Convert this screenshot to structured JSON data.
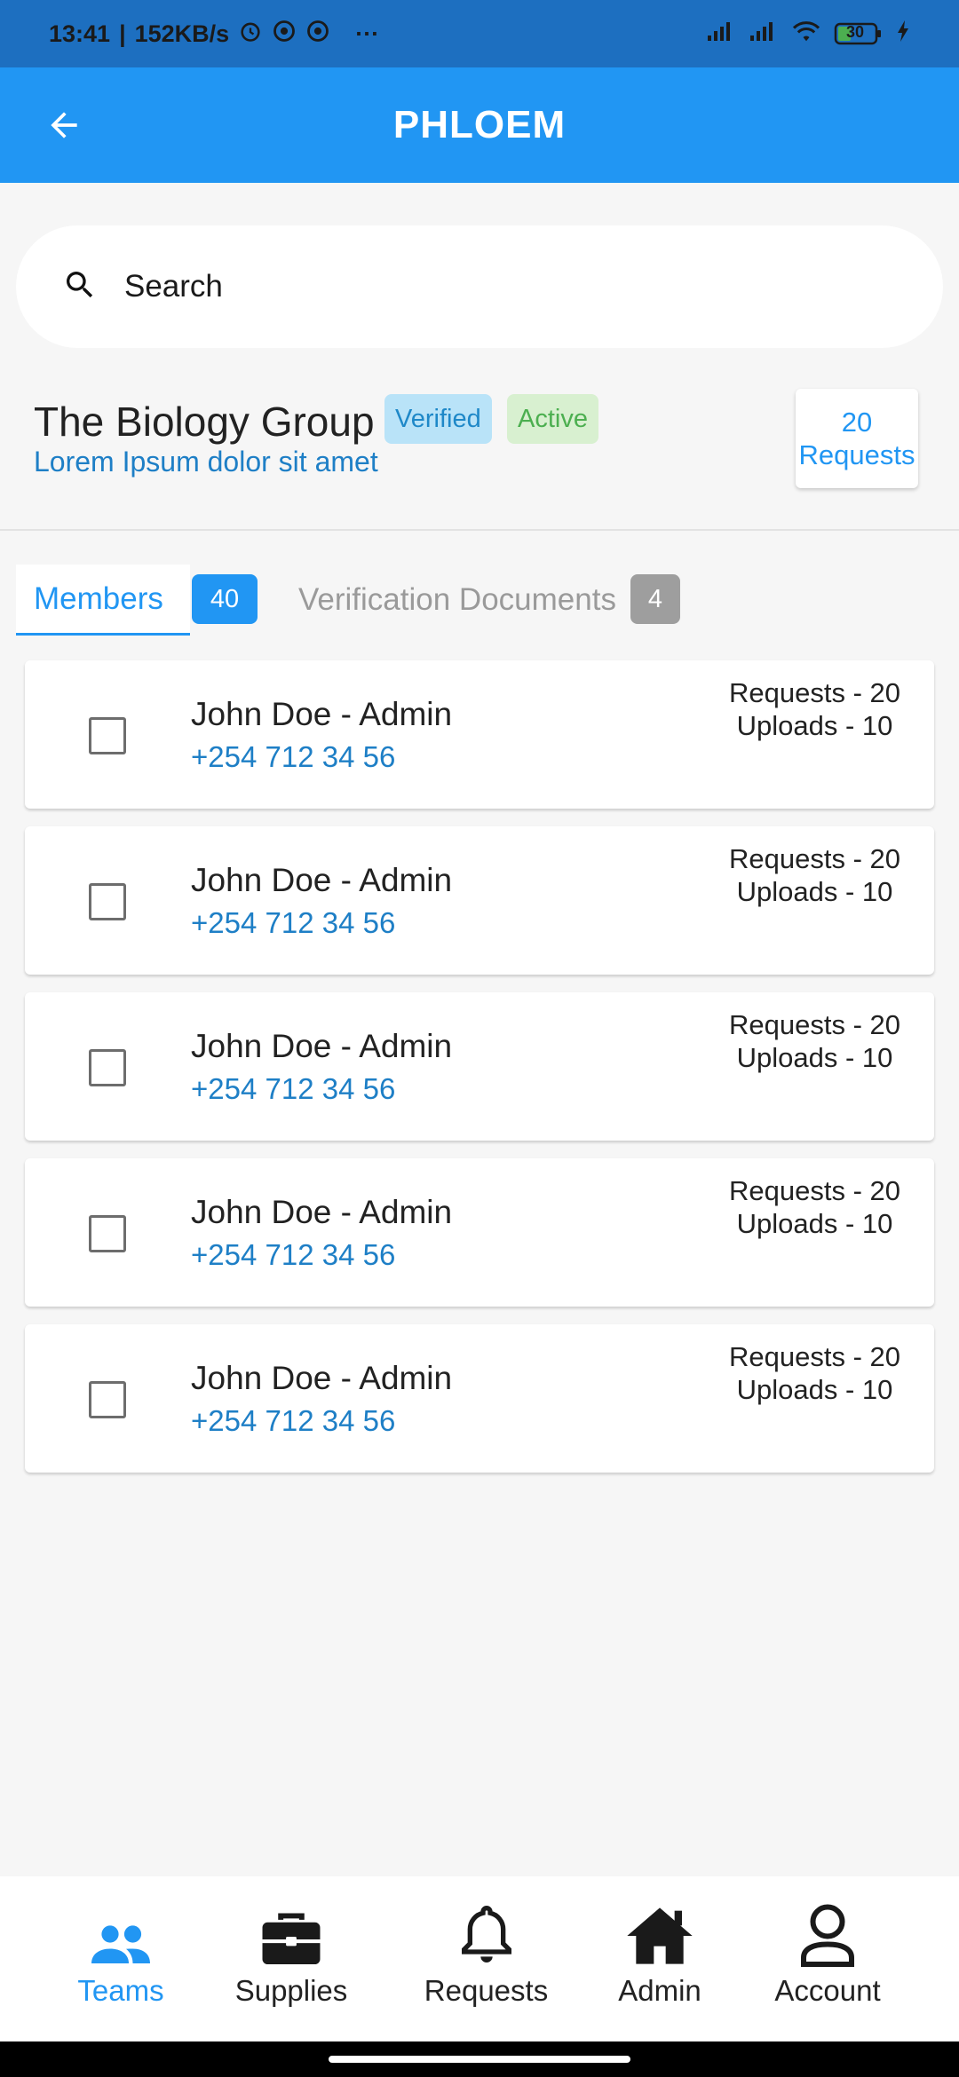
{
  "status_bar": {
    "time": "13:41",
    "speed": "152KB/s",
    "more": "···",
    "battery": "30"
  },
  "app_bar": {
    "title": "PHLOEM"
  },
  "search": {
    "placeholder": "Search"
  },
  "group": {
    "name": "The Biology Group",
    "badges": {
      "verified": "Verified",
      "active": "Active"
    },
    "subtitle": "Lorem Ipsum dolor sit amet",
    "requests_count": "20",
    "requests_label": "Requests"
  },
  "tabs": {
    "members_label": "Members",
    "members_count": "40",
    "documents_label": "Verification Documents",
    "documents_count": "4"
  },
  "members": [
    {
      "name": "John Doe - Admin",
      "phone": "+254 712 34 56",
      "requests": "Requests - 20",
      "uploads": "Uploads - 10"
    },
    {
      "name": "John Doe - Admin",
      "phone": "+254 712 34 56",
      "requests": "Requests - 20",
      "uploads": "Uploads - 10"
    },
    {
      "name": "John Doe - Admin",
      "phone": "+254 712 34 56",
      "requests": "Requests - 20",
      "uploads": "Uploads - 10"
    },
    {
      "name": "John Doe - Admin",
      "phone": "+254 712 34 56",
      "requests": "Requests - 20",
      "uploads": "Uploads - 10"
    },
    {
      "name": "John Doe - Admin",
      "phone": "+254 712 34 56",
      "requests": "Requests - 20",
      "uploads": "Uploads - 10"
    }
  ],
  "bottom_nav": [
    {
      "label": "Teams",
      "icon": "people-icon",
      "active": true
    },
    {
      "label": "Supplies",
      "icon": "briefcase-icon",
      "active": false
    },
    {
      "label": "Requests",
      "icon": "bell-icon",
      "active": false
    },
    {
      "label": "Admin",
      "icon": "home-icon",
      "active": false
    },
    {
      "label": "Account",
      "icon": "account-icon",
      "active": false
    }
  ],
  "colors": {
    "primary": "#2196f3",
    "status_bar": "#1d6fc0",
    "link": "#1e7fc6",
    "verified_bg": "#b9e3f8",
    "active_bg": "#d8f0d0",
    "active_text": "#4caf50"
  }
}
